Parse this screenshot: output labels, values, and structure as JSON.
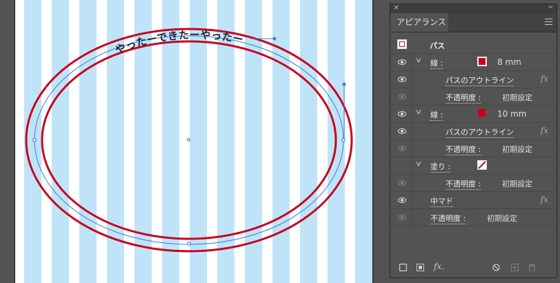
{
  "artwork": {
    "path_text": "やったーできたーやったー",
    "stripe_color": "#bfe4f8",
    "stroke_color": "#c8001e",
    "selection_color": "#3f7ad8"
  },
  "panel": {
    "tab_label": "アピアランス",
    "close_glyph": "×",
    "collapse_glyph": "‹‹",
    "rows": [
      {
        "label": "パス"
      },
      {
        "label": "線 :",
        "value": "8 mm"
      },
      {
        "label": "パスのアウトライン",
        "fx": "fx"
      },
      {
        "label": "不透明度 :",
        "value": "初期設定"
      },
      {
        "label": "線 :",
        "value": "10 mm"
      },
      {
        "label": "パスのアウトライン",
        "fx": "fx"
      },
      {
        "label": "不透明度 :",
        "value": "初期設定"
      },
      {
        "label": "塗り :"
      },
      {
        "label": "不透明度 :",
        "value": "初期設定"
      },
      {
        "label": "中マド",
        "fx": "fx"
      },
      {
        "label": "不透明度 :",
        "value": "初期設定"
      }
    ],
    "footer": {
      "fx_label": "fx."
    }
  }
}
